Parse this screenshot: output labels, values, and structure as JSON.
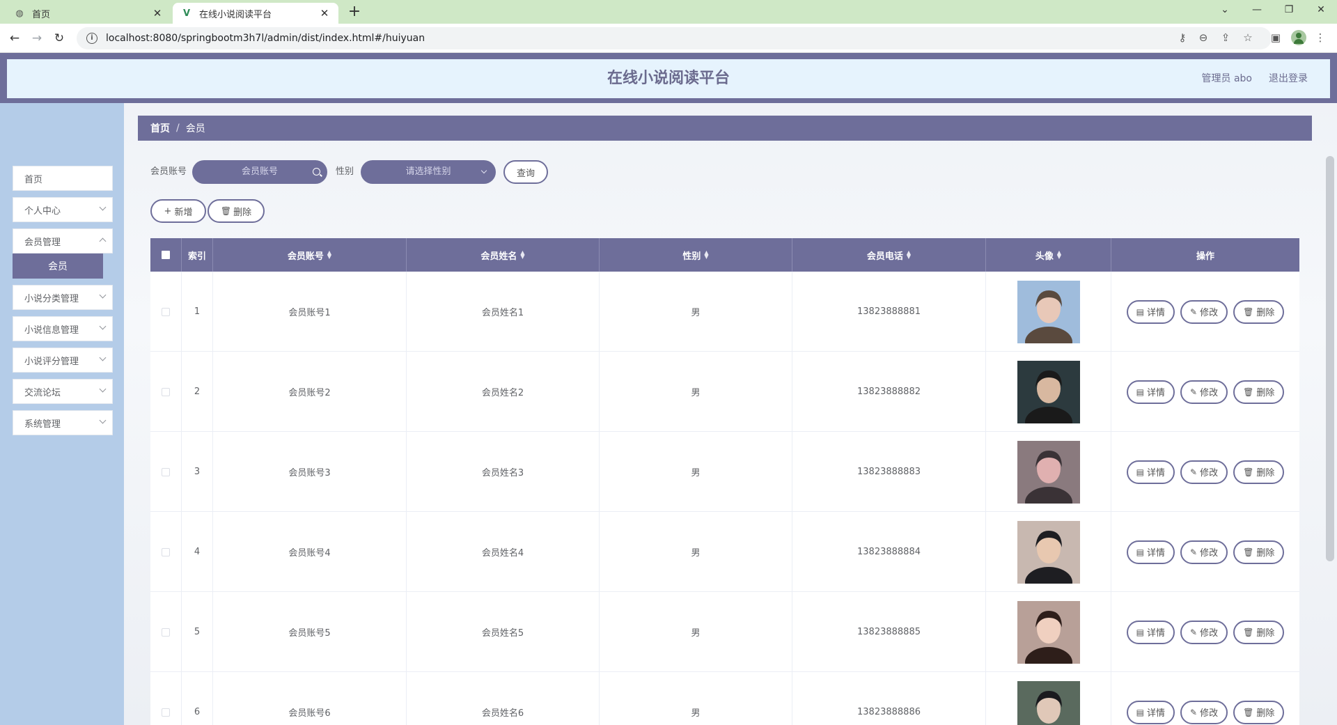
{
  "browser": {
    "tabs": [
      {
        "title": "首页",
        "icon": "globe-icon"
      },
      {
        "title": "在线小说阅读平台",
        "icon": "vue-logo-icon"
      }
    ],
    "url": "localhost:8080/springbootm3h7l/admin/dist/index.html#/huiyuan"
  },
  "header": {
    "title": "在线小说阅读平台",
    "user": "管理员 abo",
    "logout": "退出登录"
  },
  "sidebar": {
    "items": [
      {
        "label": "首页"
      },
      {
        "label": "个人中心"
      },
      {
        "label": "会员管理"
      },
      {
        "label": "小说分类管理"
      },
      {
        "label": "小说信息管理"
      },
      {
        "label": "小说评分管理"
      },
      {
        "label": "交流论坛"
      },
      {
        "label": "系统管理"
      }
    ],
    "active_sub": "会员"
  },
  "breadcrumb": {
    "home": "首页",
    "separator": "/",
    "current": "会员"
  },
  "search": {
    "account_label": "会员账号",
    "account_placeholder": "会员账号",
    "gender_label": "性别",
    "gender_placeholder": "请选择性别",
    "query_button": "查询"
  },
  "toolbar": {
    "add_label": "新增",
    "delete_label": "删除"
  },
  "table": {
    "columns": [
      "索引",
      "会员账号",
      "会员姓名",
      "性别",
      "会员电话",
      "头像",
      "操作"
    ],
    "rows": [
      {
        "index": "1",
        "account": "会员账号1",
        "name": "会员姓名1",
        "gender": "男",
        "phone": "13823888881"
      },
      {
        "index": "2",
        "account": "会员账号2",
        "name": "会员姓名2",
        "gender": "男",
        "phone": "13823888882"
      },
      {
        "index": "3",
        "account": "会员账号3",
        "name": "会员姓名3",
        "gender": "男",
        "phone": "13823888883"
      },
      {
        "index": "4",
        "account": "会员账号4",
        "name": "会员姓名4",
        "gender": "男",
        "phone": "13823888884"
      },
      {
        "index": "5",
        "account": "会员账号5",
        "name": "会员姓名5",
        "gender": "男",
        "phone": "13823888885"
      },
      {
        "index": "6",
        "account": "会员账号6",
        "name": "会员姓名6",
        "gender": "男",
        "phone": "13823888886"
      }
    ],
    "actions": {
      "detail": "详情",
      "edit": "修改",
      "delete": "删除"
    }
  },
  "colors": {
    "accent": "#6e6e9a",
    "header_bg": "#e6f3fd",
    "sidebar_bg": "#b4cce8",
    "browser_tabbar": "#cfe8c6"
  }
}
